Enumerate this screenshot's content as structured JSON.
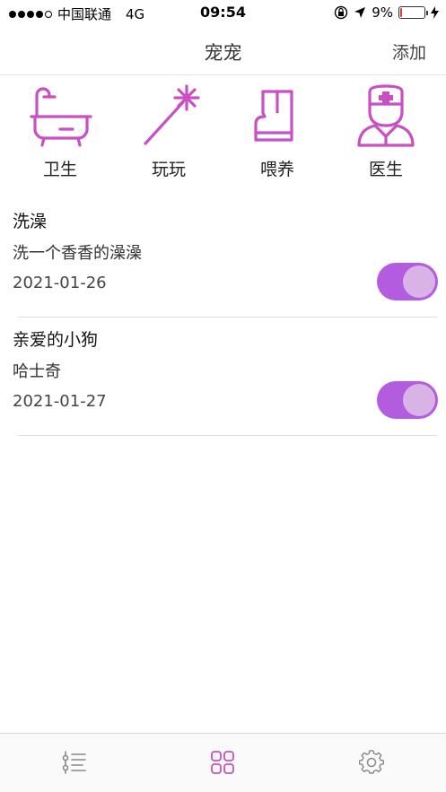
{
  "status_bar": {
    "carrier": "中国联通",
    "network": "4G",
    "time": "09:54",
    "battery": "9%",
    "battery_level": 0.09,
    "battery_color": "#e53935"
  },
  "nav": {
    "title": "宠宠",
    "add_label": "添加"
  },
  "categories": [
    {
      "label": "卫生",
      "icon": "bathtub-icon"
    },
    {
      "label": "玩玩",
      "icon": "magic-wand-icon"
    },
    {
      "label": "喂养",
      "icon": "boot-icon"
    },
    {
      "label": "医生",
      "icon": "doctor-icon"
    }
  ],
  "items": [
    {
      "title": "洗澡",
      "subtitle": "洗一个香香的澡澡",
      "date": "2021-01-26",
      "enabled": true
    },
    {
      "title": "亲爱的小狗",
      "subtitle": "哈士奇",
      "date": "2021-01-27",
      "enabled": true
    }
  ],
  "tab_bar": {
    "tabs": [
      {
        "icon": "list-icon",
        "active": false
      },
      {
        "icon": "grid-icon",
        "active": true
      },
      {
        "icon": "gear-icon",
        "active": false
      }
    ]
  },
  "colors": {
    "accent": "#c94fc4",
    "toggle_on": "#b35ce0",
    "toggle_knob": "#dab3e6"
  }
}
